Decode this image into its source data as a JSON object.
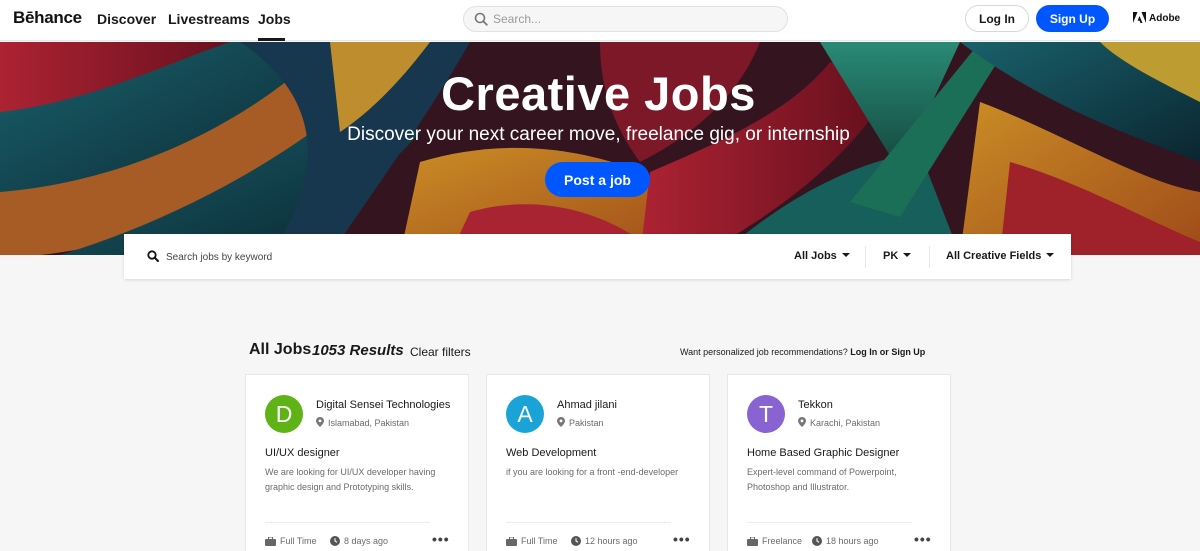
{
  "header": {
    "logo": "Bēhance",
    "nav": {
      "discover": "Discover",
      "livestreams": "Livestreams",
      "jobs": "Jobs"
    },
    "search_placeholder": "Search...",
    "login": "Log In",
    "signup": "Sign Up",
    "adobe": "Adobe"
  },
  "hero": {
    "title": "Creative Jobs",
    "subtitle": "Discover your next career move, freelance gig, or internship",
    "cta": "Post a job"
  },
  "filters": {
    "search_placeholder": "Search jobs by keyword",
    "job_type": "All Jobs",
    "country": "PK",
    "fields": "All Creative Fields"
  },
  "results": {
    "title": "All Jobs",
    "count": "1053 Results",
    "clear": "Clear filters",
    "prompt": "Want personalized job recommendations?",
    "login": "Log In",
    "or": "or",
    "signup": "Sign Up"
  },
  "jobs": [
    {
      "initial": "D",
      "avatar_color": "#5fb317",
      "company": "Digital Sensei Technologies",
      "location": "Islamabad, Pakistan",
      "title": "UI/UX designer",
      "description": "We are looking for UI/UX developer having graphic design and Prototyping skills.",
      "type": "Full Time",
      "posted": "8 days ago"
    },
    {
      "initial": "A",
      "avatar_color": "#1aa3d6",
      "company": "Ahmad jilani",
      "location": "Pakistan",
      "title": "Web Development",
      "description": "if you are looking for a front -end-developer",
      "type": "Full Time",
      "posted": "12 hours ago"
    },
    {
      "initial": "T",
      "avatar_color": "#8a63d2",
      "company": "Tekkon",
      "location": "Karachi, Pakistan",
      "title": "Home Based Graphic Designer",
      "description": "Expert-level command of Powerpoint, Photoshop and Illustrator.",
      "type": "Freelance",
      "posted": "18 hours ago"
    }
  ]
}
